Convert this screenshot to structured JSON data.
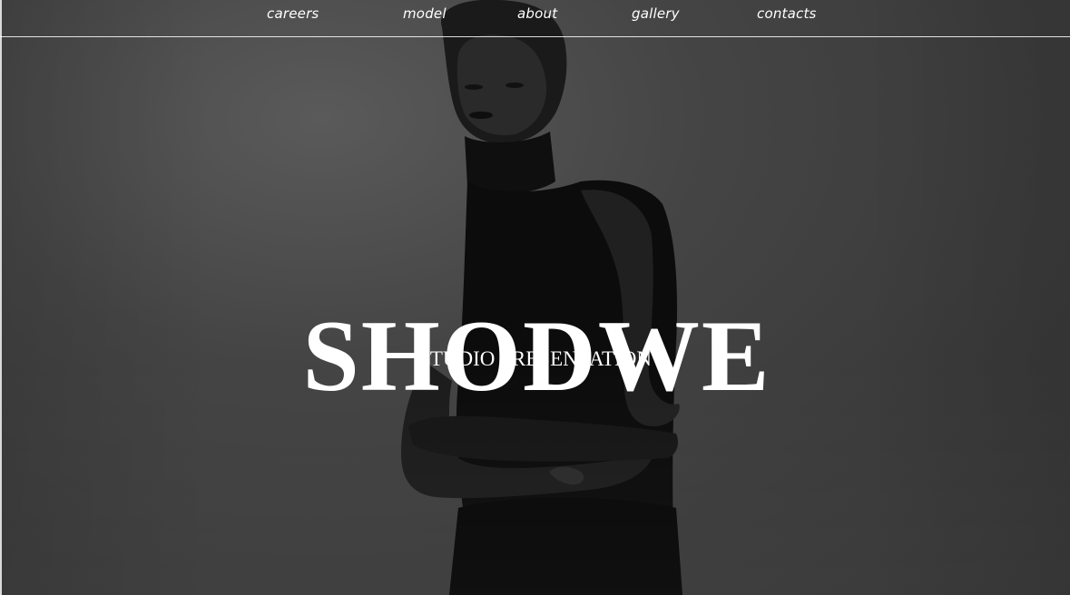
{
  "nav": {
    "items": [
      {
        "label": "careers"
      },
      {
        "label": "model"
      },
      {
        "label": "about"
      },
      {
        "label": "gallery"
      },
      {
        "label": "contacts"
      }
    ]
  },
  "hero": {
    "brand": "SHODWE",
    "subtitle": "STUDIO PRESENTATION"
  },
  "colors": {
    "background": "#3a3a3a",
    "text": "#ffffff"
  }
}
